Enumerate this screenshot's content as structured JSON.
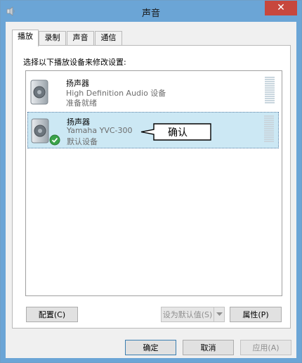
{
  "window": {
    "title": "声音"
  },
  "tabs": [
    {
      "label": "播放",
      "active": true
    },
    {
      "label": "录制",
      "active": false
    },
    {
      "label": "声音",
      "active": false
    },
    {
      "label": "通信",
      "active": false
    }
  ],
  "instruction": "选择以下播放设备来修改设置:",
  "devices": [
    {
      "name": "扬声器",
      "description": "High Definition Audio 设备",
      "status": "准备就绪",
      "selected": false
    },
    {
      "name": "扬声器",
      "description": "Yamaha YVC-300",
      "status": "默认设备",
      "selected": true,
      "default_badge": "check-icon"
    }
  ],
  "callout": {
    "text": "确认"
  },
  "panel_buttons": {
    "configure": "配置(C)",
    "set_default": "设为默认值(S)",
    "properties": "属性(P)"
  },
  "dialog_buttons": {
    "ok": "确定",
    "cancel": "取消",
    "apply": "应用(A)"
  },
  "colors": {
    "titlebar": "#6ba5d6",
    "close": "#c7473d",
    "selection": "#cce8f4",
    "check": "#3aa34a"
  }
}
